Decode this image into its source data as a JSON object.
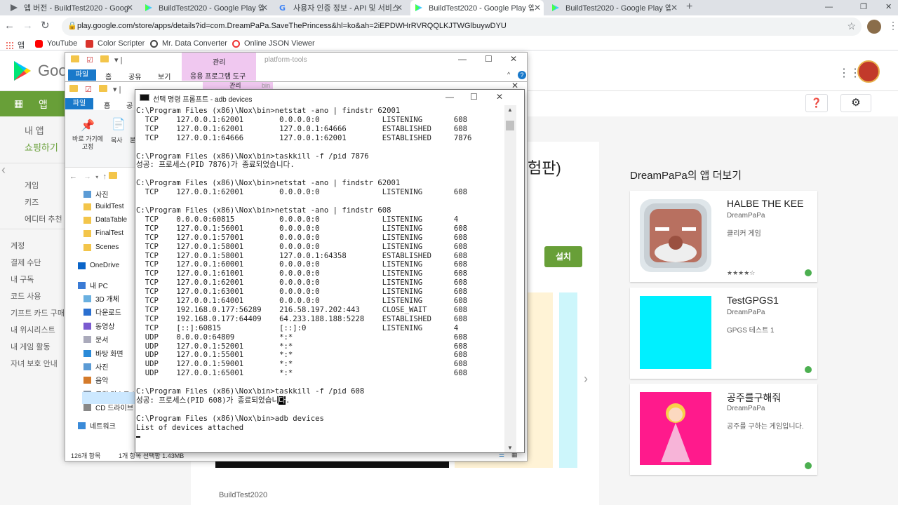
{
  "browser": {
    "tabs": [
      {
        "title": "앱 버전 - BuildTest2020 - Goog",
        "icon": "play-console-icon"
      },
      {
        "title": "BuildTest2020 - Google Play 앱",
        "icon": "play-icon"
      },
      {
        "title": "사용자 인증 정보 - API 및 서비스",
        "icon": "google-icon"
      },
      {
        "title": "BuildTest2020 - Google Play 앱",
        "icon": "play-icon"
      },
      {
        "title": "BuildTest2020 - Google Play 앱",
        "icon": "play-icon"
      }
    ],
    "url": "play.google.com/store/apps/details?id=com.DreamPaPa.SaveThePrincess&hl=ko&ah=2iEPDWHrRVRQQLKJTWGlbuywDYU",
    "bookmarks": [
      {
        "label": "앱"
      },
      {
        "label": "YouTube"
      },
      {
        "label": "Color Scripter"
      },
      {
        "label": "Mr. Data Converter"
      },
      {
        "label": "Online JSON Viewer"
      }
    ]
  },
  "play": {
    "logo_text": "Goo",
    "nav_label": "앱",
    "sidebar": {
      "top": [
        "내 앱",
        "쇼핑하기"
      ],
      "categories": [
        "게임",
        "키즈",
        "에디터 추천"
      ],
      "account": [
        "계정",
        "결제 수단",
        "내 구독",
        "코드 사용",
        "기프트 카드 구매",
        "내 위시리스트",
        "내 게임 활동",
        "자녀 보호 안내"
      ]
    },
    "title_fragment": "험판)",
    "install_label": "설치",
    "developer_footer": "BuildTest2020",
    "more_title": "DreamPaPa의 앱 더보기",
    "more_apps": [
      {
        "name": "HALBE THE KEE",
        "dev": "DreamPaPa",
        "desc": "클리커 게임",
        "stars": "★★★★☆"
      },
      {
        "name": "TestGPGS1",
        "dev": "DreamPaPa",
        "desc": "GPGS 테스트 1",
        "stars": ""
      },
      {
        "name": "공주를구해줘",
        "dev": "DreamPaPa",
        "desc": "공주를 구하는 게임입니다.",
        "stars": ""
      }
    ]
  },
  "explorer1": {
    "context_tab": "관리",
    "title": "platform-tools",
    "ribbon": {
      "file": "파일",
      "home": "홈",
      "share": "공유",
      "view": "보기",
      "apptools": "응용 프로그램 도구"
    }
  },
  "explorer2": {
    "context_tab": "관리",
    "title": "bin",
    "ribbon": {
      "file": "파일",
      "home": "홈",
      "share": "공"
    },
    "pin_label": "바로 가기에\n고정",
    "copy_label": "복사",
    "paste_label": "붙",
    "nav": [
      {
        "label": "사진",
        "icon": "pictures-icon"
      },
      {
        "label": "BuildTest",
        "icon": "folder-icon"
      },
      {
        "label": "DataTable",
        "icon": "folder-icon"
      },
      {
        "label": "FinalTest",
        "icon": "folder-icon"
      },
      {
        "label": "Scenes",
        "icon": "folder-icon"
      },
      {
        "label": "OneDrive",
        "icon": "onedrive-icon"
      },
      {
        "label": "내 PC",
        "icon": "pc-icon"
      },
      {
        "label": "3D 개체",
        "icon": "3d-icon"
      },
      {
        "label": "다운로드",
        "icon": "download-icon"
      },
      {
        "label": "동영상",
        "icon": "video-icon"
      },
      {
        "label": "문서",
        "icon": "document-icon"
      },
      {
        "label": "바탕 화면",
        "icon": "desktop-icon"
      },
      {
        "label": "사진",
        "icon": "pictures-icon"
      },
      {
        "label": "음악",
        "icon": "music-icon"
      },
      {
        "label": "로컬 디스크 (C",
        "icon": "disk-icon"
      },
      {
        "label": "CD 드라이브",
        "icon": "cd-icon"
      },
      {
        "label": "네트워크",
        "icon": "network-icon"
      }
    ],
    "status_items": "126개 항목",
    "status_selected": "1개 항목 선택함 1.43MB"
  },
  "cmd": {
    "title": "선택 명령 프롬프트 - adb  devices",
    "lines_before": [
      "C:\\Program Files (x86)\\Nox\\bin>netstat -ano | findstr 62001",
      "  TCP    127.0.0.1:62001        0.0.0.0:0              LISTENING       608",
      "  TCP    127.0.0.1:62001        127.0.0.1:64666        ESTABLISHED     608",
      "  TCP    127.0.0.1:64666        127.0.0.1:62001        ESTABLISHED     7876",
      "",
      "C:\\Program Files (x86)\\Nox\\bin>taskkill -f /pid 7876",
      "성공: 프로세스(PID 7876)가 종료되었습니다.",
      "",
      "C:\\Program Files (x86)\\Nox\\bin>netstat -ano | findstr 62001",
      "  TCP    127.0.0.1:62001        0.0.0.0:0              LISTENING       608",
      "",
      "C:\\Program Files (x86)\\Nox\\bin>netstat -ano | findstr 608",
      "  TCP    0.0.0.0:60815          0.0.0.0:0              LISTENING       4",
      "  TCP    127.0.0.1:56001        0.0.0.0:0              LISTENING       608",
      "  TCP    127.0.0.1:57001        0.0.0.0:0              LISTENING       608",
      "  TCP    127.0.0.1:58001        0.0.0.0:0              LISTENING       608",
      "  TCP    127.0.0.1:58001        127.0.0.1:64358        ESTABLISHED     608",
      "  TCP    127.0.0.1:60001        0.0.0.0:0              LISTENING       608",
      "  TCP    127.0.0.1:61001        0.0.0.0:0              LISTENING       608",
      "  TCP    127.0.0.1:62001        0.0.0.0:0              LISTENING       608",
      "  TCP    127.0.0.1:63001        0.0.0.0:0              LISTENING       608",
      "  TCP    127.0.0.1:64001        0.0.0.0:0              LISTENING       608",
      "  TCP    192.168.0.177:56289    216.58.197.202:443     CLOSE_WAIT      608",
      "  TCP    192.168.0.177:64409    64.233.188.188:5228    ESTABLISHED     608",
      "  TCP    [::]:60815             [::]:0                 LISTENING       4",
      "  UDP    0.0.0.0:64809          *:*                                    608",
      "  UDP    127.0.0.1:52001        *:*                                    608",
      "  UDP    127.0.0.1:55001        *:*                                    608",
      "  UDP    127.0.0.1:59001        *:*                                    608",
      "  UDP    127.0.0.1:65001        *:*                                    608",
      "",
      "C:\\Program Files (x86)\\Nox\\bin>taskkill -f /pid 608"
    ],
    "line_success_prefix": "성공: 프로세스(PID 608)가 종료되었습니",
    "line_success_selected": "다",
    "line_success_suffix": ".",
    "lines_after": [
      "",
      "C:\\Program Files (x86)\\Nox\\bin>adb devices",
      "List of devices attached"
    ]
  }
}
